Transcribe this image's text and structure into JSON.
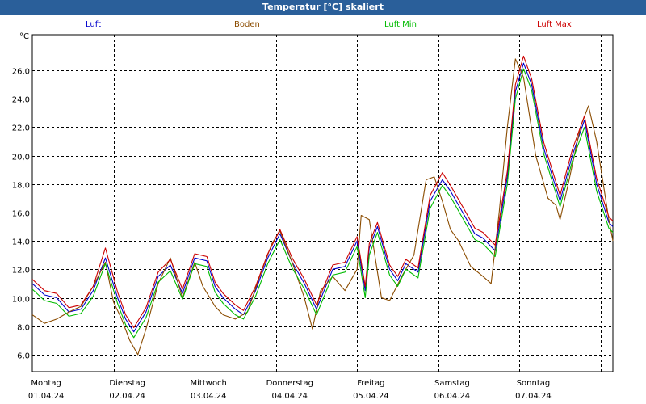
{
  "window": {
    "title": "Temperatur [°C] skaliert"
  },
  "colors": {
    "luft": "#0000cc",
    "boden": "#8b4c00",
    "luft_min": "#00bb00",
    "luft_max": "#cc0000",
    "titlebar": "#2a5f9a"
  },
  "chart_data": {
    "type": "line",
    "title": "Temperatur [°C] skaliert",
    "ylabel": "°C",
    "ylim": [
      4.8,
      28.5
    ],
    "yticks": [
      6.0,
      8.0,
      10.0,
      12.0,
      14.0,
      16.0,
      18.0,
      20.0,
      22.0,
      24.0,
      26.0
    ],
    "ytick_labels": [
      "6,0",
      "8,0",
      "10,0",
      "12,0",
      "14,0",
      "16,0",
      "18,0",
      "20,0",
      "22,0",
      "24,0",
      "26,0"
    ],
    "xlim": [
      0,
      7.15
    ],
    "x_ticks": [
      {
        "day": "Montag",
        "date": "01.04.24"
      },
      {
        "day": "Dienstag",
        "date": "02.04.24"
      },
      {
        "day": "Mittwoch",
        "date": "03.04.24"
      },
      {
        "day": "Donnerstag",
        "date": "04.04.24"
      },
      {
        "day": "Freitag",
        "date": "05.04.24"
      },
      {
        "day": "Samstag",
        "date": "06.04.24"
      },
      {
        "day": "Sonntag",
        "date": "07.04.24"
      }
    ],
    "grid": true,
    "legend_position": "top",
    "x_unit": "days since 01.04.24 00:00",
    "series": [
      {
        "name": "Luft",
        "key": "luft",
        "x": [
          0,
          0.15,
          0.3,
          0.45,
          0.6,
          0.75,
          0.9,
          1.05,
          1.15,
          1.25,
          1.4,
          1.55,
          1.7,
          1.85,
          2.0,
          2.15,
          2.25,
          2.35,
          2.5,
          2.6,
          2.75,
          2.9,
          3.05,
          3.2,
          3.35,
          3.5,
          3.7,
          3.85,
          4.0,
          4.1,
          4.15,
          4.25,
          4.4,
          4.5,
          4.6,
          4.75,
          4.9,
          5.05,
          5.15,
          5.3,
          5.45,
          5.55,
          5.7,
          5.85,
          5.95,
          6.05,
          6.15,
          6.3,
          6.5,
          6.65,
          6.8,
          6.95,
          7.1,
          7.15
        ],
        "y": [
          11.0,
          10.2,
          10.0,
          9.0,
          9.2,
          10.5,
          12.8,
          10.0,
          8.5,
          7.6,
          9.0,
          11.5,
          12.3,
          10.3,
          12.8,
          12.6,
          10.8,
          10.0,
          9.2,
          8.8,
          10.5,
          12.8,
          14.5,
          12.5,
          11.0,
          9.2,
          12.0,
          12.2,
          14.0,
          10.5,
          13.5,
          15.0,
          12.0,
          11.2,
          12.4,
          11.8,
          16.8,
          18.3,
          17.5,
          16.0,
          14.5,
          14.2,
          13.3,
          18.5,
          24.5,
          26.5,
          25.0,
          20.5,
          16.8,
          20.0,
          22.5,
          18.0,
          15.3,
          15.0
        ]
      },
      {
        "name": "Boden",
        "key": "boden",
        "x": [
          0,
          0.15,
          0.3,
          0.45,
          0.6,
          0.75,
          0.9,
          1.0,
          1.1,
          1.2,
          1.3,
          1.4,
          1.55,
          1.7,
          1.85,
          2.0,
          2.1,
          2.25,
          2.35,
          2.5,
          2.65,
          2.8,
          2.95,
          3.05,
          3.2,
          3.35,
          3.45,
          3.55,
          3.7,
          3.85,
          4.0,
          4.05,
          4.15,
          4.3,
          4.4,
          4.55,
          4.7,
          4.85,
          4.95,
          5.05,
          5.15,
          5.25,
          5.4,
          5.55,
          5.65,
          5.75,
          5.85,
          5.95,
          6.05,
          6.2,
          6.35,
          6.45,
          6.5,
          6.6,
          6.75,
          6.85,
          6.95,
          7.1,
          7.15
        ],
        "y": [
          8.8,
          8.2,
          8.5,
          9.0,
          9.4,
          10.8,
          12.5,
          9.7,
          8.5,
          7.0,
          6.0,
          7.8,
          11.0,
          12.8,
          10.0,
          12.5,
          10.8,
          9.4,
          8.8,
          8.5,
          9.0,
          11.5,
          13.8,
          14.7,
          12.5,
          10.0,
          7.8,
          10.5,
          11.5,
          10.5,
          12.0,
          15.8,
          15.5,
          10.0,
          9.8,
          11.5,
          13.0,
          18.3,
          18.5,
          16.8,
          14.8,
          14.0,
          12.2,
          11.5,
          11.0,
          16.0,
          22.0,
          26.8,
          25.5,
          20.0,
          17.0,
          16.5,
          15.5,
          18.0,
          22.0,
          23.5,
          21.0,
          15.5,
          14.0
        ]
      },
      {
        "name": "Luft Min",
        "key": "luft_min",
        "x": [
          0,
          0.15,
          0.3,
          0.45,
          0.6,
          0.75,
          0.9,
          1.05,
          1.15,
          1.25,
          1.4,
          1.55,
          1.7,
          1.85,
          2.0,
          2.15,
          2.25,
          2.35,
          2.5,
          2.6,
          2.75,
          2.9,
          3.05,
          3.2,
          3.35,
          3.5,
          3.7,
          3.85,
          4.0,
          4.1,
          4.15,
          4.25,
          4.4,
          4.5,
          4.6,
          4.75,
          4.9,
          5.05,
          5.15,
          5.3,
          5.45,
          5.55,
          5.7,
          5.85,
          5.95,
          6.05,
          6.15,
          6.3,
          6.5,
          6.65,
          6.8,
          6.95,
          7.1,
          7.15
        ],
        "y": [
          10.6,
          9.8,
          9.6,
          8.7,
          8.9,
          10.1,
          12.4,
          9.6,
          8.1,
          7.2,
          8.6,
          11.1,
          11.9,
          9.9,
          12.4,
          12.2,
          10.4,
          9.6,
          8.8,
          8.5,
          10.1,
          12.4,
          14.1,
          12.1,
          10.6,
          8.8,
          11.6,
          11.8,
          13.6,
          10.0,
          13.0,
          14.6,
          11.6,
          10.8,
          12.0,
          11.4,
          16.3,
          17.9,
          17.1,
          15.6,
          14.1,
          13.8,
          12.9,
          18.0,
          24.0,
          26.1,
          24.6,
          20.1,
          16.4,
          19.6,
          22.0,
          17.5,
          14.9,
          14.6
        ]
      },
      {
        "name": "Luft Max",
        "key": "luft_max",
        "x": [
          0,
          0.15,
          0.3,
          0.45,
          0.6,
          0.75,
          0.9,
          1.05,
          1.15,
          1.25,
          1.4,
          1.55,
          1.7,
          1.85,
          2.0,
          2.15,
          2.25,
          2.35,
          2.5,
          2.6,
          2.75,
          2.9,
          3.05,
          3.2,
          3.35,
          3.5,
          3.7,
          3.85,
          4.0,
          4.1,
          4.15,
          4.25,
          4.4,
          4.5,
          4.6,
          4.75,
          4.9,
          5.05,
          5.15,
          5.3,
          5.45,
          5.55,
          5.7,
          5.85,
          5.95,
          6.05,
          6.15,
          6.3,
          6.5,
          6.65,
          6.8,
          6.95,
          7.1,
          7.15
        ],
        "y": [
          11.3,
          10.5,
          10.3,
          9.3,
          9.5,
          10.8,
          13.5,
          10.4,
          8.8,
          7.9,
          9.3,
          11.8,
          12.7,
          10.6,
          13.1,
          12.9,
          11.1,
          10.3,
          9.5,
          9.1,
          10.8,
          13.1,
          14.8,
          12.8,
          11.3,
          9.5,
          12.3,
          12.5,
          14.3,
          10.8,
          13.8,
          15.3,
          12.3,
          11.5,
          12.7,
          12.1,
          17.2,
          18.8,
          17.9,
          16.4,
          14.9,
          14.6,
          13.7,
          18.9,
          25.0,
          27.0,
          25.4,
          20.9,
          17.2,
          20.4,
          22.8,
          18.4,
          15.7,
          15.4
        ]
      }
    ]
  }
}
